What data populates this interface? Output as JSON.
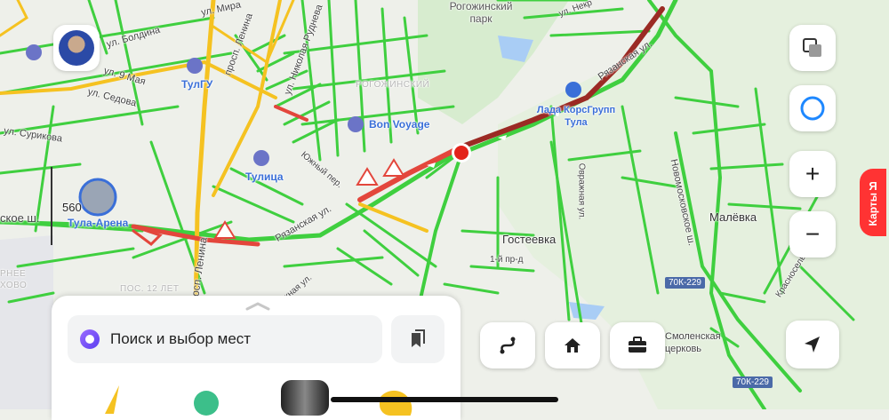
{
  "map": {
    "streets": {
      "boldina": "ул. Болдина",
      "mira": "ул. Мира",
      "lenina_top": "просп. Ленина",
      "lenina_bottom": "просп. Ленина",
      "rudneva": "ул. Николая Руднева",
      "may9": "ул. 9 Мая",
      "sedova": "ул. Седова",
      "surikova": "ул. Сурикова",
      "ryazanskaya_top": "Рязанская ул.",
      "ryazanskaya_bottom": "Рязанская ул.",
      "yuzhny": "Южный пер.",
      "nekr": "ул. Некр",
      "ovrazhnaya": "Овражная ул.",
      "novomoskovskoe": "Новомосковское ш.",
      "krasnoselskaya": "Красносельская ул.",
      "pr1": "1-й пр-д",
      "yuzhnaya": "Южная ул.",
      "skoe": "ское ш."
    },
    "places": {
      "rogozhinsky_park": "Рогожинский парк",
      "rogozhinsky": "РОГОЖИНСКИЙ",
      "gosteevka": "Гостеевка",
      "malevka": "Малёвка",
      "smolenskaya": "Смоленская церковь",
      "rnee": "РНЕЕ",
      "hovo": "ХОВО",
      "pos12": "ПОС. 12 ЛЕТ"
    },
    "pois": {
      "tulgu": "ТулГУ",
      "bon_voyage": "Bon Voyage",
      "tulitsa": "Тулица",
      "lada": "Лада КорсГрупп Тула",
      "tula_arena": "Тула-Арена"
    },
    "road_shields": [
      "70К-229",
      "70К-229"
    ],
    "scale_value": "560",
    "colors": {
      "free": "#3fcf3f",
      "slow": "#f5c221",
      "jam": "#e3463c",
      "heavy": "#9b2a24"
    }
  },
  "controls": {
    "layers_icon": "layers-icon",
    "alice_icon": "alice-icon",
    "zoom_in": "+",
    "zoom_out": "−",
    "locate_icon": "navigation-arrow-icon",
    "yandex_label": "Карты",
    "yandex_letter": "Я"
  },
  "sheet": {
    "search_placeholder": "Поиск и выбор мест",
    "quick": [
      "route-icon",
      "home-icon",
      "briefcase-icon"
    ]
  }
}
